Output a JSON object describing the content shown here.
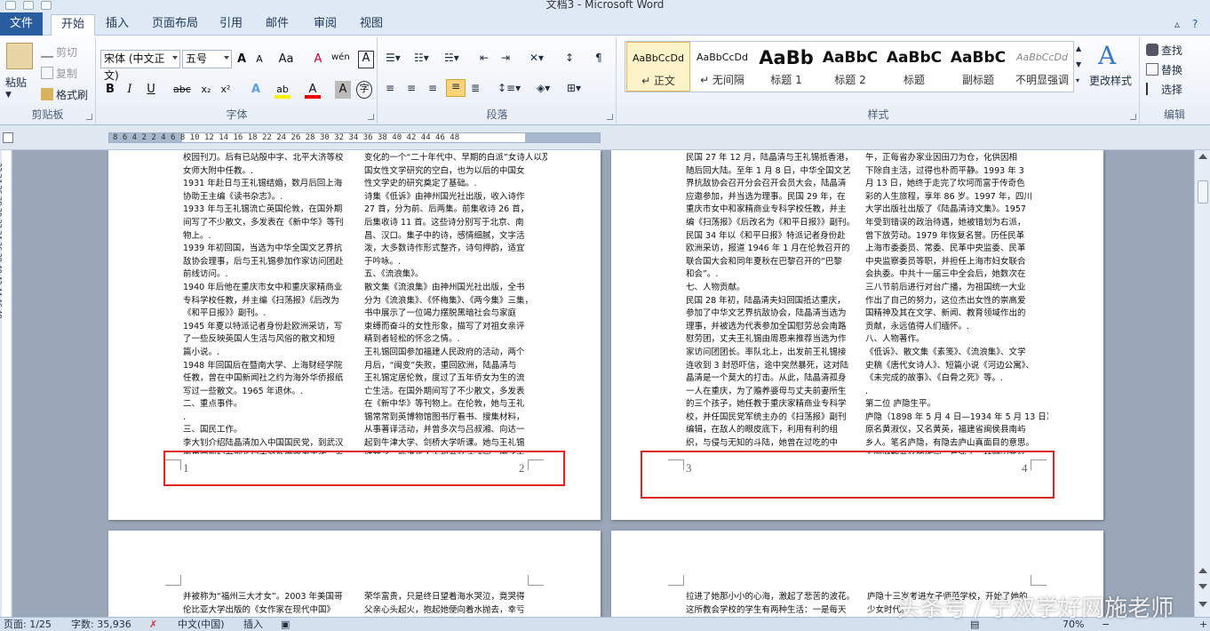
{
  "window": {
    "title": "文档3 - Microsoft Word"
  },
  "tabs": [
    "文件",
    "开始",
    "插入",
    "页面布局",
    "引用",
    "邮件",
    "审阅",
    "视图"
  ],
  "clipboard": {
    "paste": "粘贴",
    "cut": "剪切",
    "copy": "复制",
    "format_painter": "格式刷",
    "label": "剪贴板"
  },
  "font": {
    "name": "宋体 (中文正文)",
    "size": "五号",
    "grow": "A",
    "shrink": "A",
    "case": "Aa",
    "clear": "A",
    "phonetic": "wén",
    "border": "A",
    "bold": "B",
    "italic": "I",
    "underline": "U",
    "strike": "abc",
    "sub": "x₂",
    "sup": "x²",
    "effects": "A",
    "highlight": "ab",
    "color": "A",
    "char_shade": "A",
    "enclose": "字",
    "label": "字体"
  },
  "paragraph": {
    "label": "段落"
  },
  "styles": {
    "items": [
      {
        "sample": "AaBbCcDd",
        "name": "↵ 正文",
        "selected": true
      },
      {
        "sample": "AaBbCcDd",
        "name": "↵ 无间隔"
      },
      {
        "sample": "AaBb",
        "name": "标题 1"
      },
      {
        "sample": "AaBbC",
        "name": "标题 2"
      },
      {
        "sample": "AaBbC",
        "name": "标题"
      },
      {
        "sample": "AaBbC",
        "name": "副标题"
      },
      {
        "sample": "AaBbCcDd",
        "name": "不明显强调"
      }
    ],
    "change": "更改样式",
    "label": "样式"
  },
  "editing": {
    "find": "查找",
    "replace": "替换",
    "select": "选择",
    "label": "编辑"
  },
  "ruler": {
    "numbers": "8 6 4 2   2 4 6 8 10 12 14 16 18   22 24 26 28 30 32 34 36 38 40 42 44 46 48",
    "vnumbers": "22 24 26 28 30 32 34 36 38 40 42 44 46 48"
  },
  "pages": [
    {
      "number": "1",
      "left": "校园刊刀。后有已站殷中字、北平大济等校\n女师大附中任教。.\n1931 年赴日与王礼锡结婚，数月后回上海\n协助王主编《读书杂志》。.\n1933 年与王礼锡流亡英国伦敦，在国外期\n间写了不少散文，多发表在《新中华》等刊\n物上。.\n1939 年初回国，当选为中华全国文艺界抗\n敌协会理事，后与王礼锡参加作家访问团赴\n前线访问。.\n1940 年后他在重庆市女中和重庆家精商业\n专科学校任教，并主编《扫荡报》《后改为\n《和平日报》》副刊。.\n1945 年夏以特派记者身份赴欧洲采访，写\n了一些反映英国人生活与风俗的散文和短\n篇小说。.\n1948 年回国后在暨南大学、上海财经学院\n任教，曾在中国新闻社之约为海外华侨报纸\n写过一些散文。1965 年退休。.\n二、重点事件。\n.\n三、国民工作。\n李大钊介绍陆晶清加入中国国民党，到武汉\n中央党部妇女部长何香凝处做文书工作，直",
      "right": "变化的一个“二十年代中、早期的白派”女诗人以及\n国女性文学研究的空白，也为以后的中国女\n性文学史的研究奠定了基础。.\n诗集《低诉》由神州国光社出版，收入诗作\n27 首，分为前、后两集。前集收诗 26 首，\n后集收诗 11 首。这些诗分别写于北京、南\n昌、汉口。集子中的诗，感情细腻，文字活\n泼，大多数诗作形式整齐，诗句押韵，适宜\n于吟咏。.\n五、《流浪集》。\n散文集《流浪集》由神州国光社出版，全书\n分为《流浪集》、《怀梅集》、《两今集》三集，\n书中展示了一位竭力摆脱黑暗社会与家庭\n束缚而奋斗的女性形象，描写了对祖女亲评\n精到者轻松的怀念之情。.\n王礼锡回国参加福建人民政府的活动，两个\n月后，“闽变”失败，重回欧洲，陆晶清与\n王礼锡定居伦敦，度过了五年侨女为生的流\n亡生活。在国外期间写了不少散文，多发表\n在《新中华》等刊物上。在伦敦，她与王礼\n锡常常到英博物馆图书厅看书、搜集材料，\n从事著译活动，并曾多次与吕叔湘、向达一\n起到牛津大学、剑桥大学听课。她与王礼锡\n结交了一批进步人士和著名活动家，做了大"
    },
    {
      "number": "2",
      "left": "",
      "right": ""
    },
    {
      "number": "3",
      "left": "民国 27 年 12 月，陆晶清与王礼锡抵香港，\n随后回大陆。至年 1 月 8 日，中华全国文艺\n界抗敌协会召开分会召开会员大会，陆晶清\n应邀参加，并当选为理事。民国 29 年，在\n重庆市女中和家精商业专科学校任教，并主\n编《扫荡报》《后改名为《和平日报》》副刊。\n民国 34 年以《和平日报》特派记者身份赴\n欧洲采访，报道 1946 年 1 月在伦敦召开的\n联合国大会和同年夏秋在巴黎召开的“巴黎\n和会”。.\n七、人物贡献。\n民国 28 年初，陆晶清夫妇回国抵达重庆，\n参加了中华文艺界抗敌协会，陆晶清当选为\n理事，并被选为代表参加全国慰劳总会南路\n慰劳团，丈夫王礼锡由周恩来推荐当选为作\n家访问团团长。率队北上，出发前王礼锡接\n连收到 3 封恐吓信，途中突然暴死，这对陆\n晶清是一个莫大的打击。从此，陆晶清孤身\n一人在重庆，为了赡养婆母与丈夫前妻所生\n的三个孩子，她任教于重庆家精商业专科学\n校，并任国民党军统主办的《扫荡报》副刊\n编辑，在敌人的眼皮底下，利用有利的组\n织，与侵与无知的斗陆，她曾在过吃的中",
      "right": "午，正每省办家业因田刀为仓，化供因相\n下除自主活，过得也朴而平静。1993 年 3\n月 13 日，她终于走完了坎坷而富于传奇色\n彩的人生旅程，享年 86 岁。1997 年，四川\n大学出版社出版了《陆晶清诗文集》。1957\n年受到错误的政治待遇，她被错划为右派，\n曾下放劳动。1979 年恢复名誉。历任民革\n上海市委委员、常委、民革中央监委、民革\n中央监察委员等职，并担任上海市妇女联合\n会执委。中共十一届三中全会后，她数次在\n三八节前后进行对台广播，为祖国统一大业\n作出了自己的努力，这位杰出女性的崇高爱\n国精神及其在文学、新闻、教育领域作出的\n贡献，永远值得人们缅怀。.\n八、人物著作。\n《低诉》、散文集《素笺》、《流浪集》、文学\n史稿《唐代女诗人》、短篇小说《河边公寓》、\n《未完成的故事》、《白骨之死》等。.\n.\n第二位 庐隐生平。\n庐隐（1898 年 5 月 4 日—1934 年 5 月 13 日）\n原名黄淑仪，又名黄英，福建省闽侯县南屿\n乡人。笔名庐隐，有隐去庐山真面目的意思。\n五四时期著名的作家。与冰心、林徽因齐名"
    },
    {
      "number": "4",
      "left": "",
      "right": ""
    },
    {
      "number": "",
      "left": "并被称为“福州三大才女”。2003 年美国哥\n伦比亚大学出版的《女作家在现代中国》",
      "right": "荣华富贵，只是终日望着海水哭泣，竟哭得\n父亲心头起火，抱起她便向着水抛去，幸亏"
    },
    {
      "number": "",
      "left": "拉进了她那小小的心海，激起了悲苦的波花。\n这所教会学校的学生有两种生活：一是每天",
      "right": "庐隐十三岁考进女子师范学校，开始了她的\n少女时代。"
    }
  ],
  "status": {
    "page": "页面: 1/25",
    "words": "字数: 35,936",
    "lang": "中文(中国)",
    "insert": "插入",
    "zoom": "70%"
  },
  "watermark": "头条号 / 宁双学好网施老师"
}
